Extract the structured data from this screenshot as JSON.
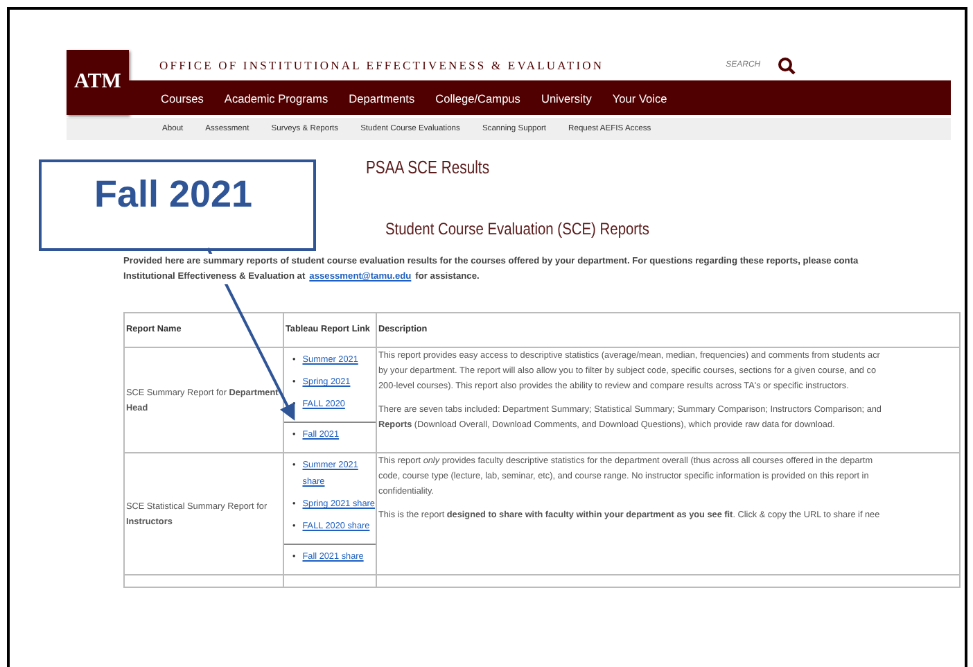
{
  "header": {
    "logo": "ATM",
    "site_title": "OFFICE OF INSTITUTIONAL EFFECTIVENESS & EVALUATION",
    "search_label": "SEARCH"
  },
  "main_nav": [
    "Courses",
    "Academic Programs",
    "Departments",
    "College/Campus",
    "University",
    "Your Voice"
  ],
  "sub_nav": [
    "About",
    "Assessment",
    "Surveys & Reports",
    "Student Course Evaluations",
    "Scanning Support",
    "Request AEFIS Access"
  ],
  "page_title": "PSAA SCE Results",
  "section_title": "Student Course Evaluation (SCE) Reports",
  "intro": {
    "line_1": "Provided here are summary reports of student course evaluation results for the courses offered by your department. For  questions regarding these reports, please conta",
    "line_2_before": "Institutional Effectiveness & Evaluation at",
    "line_2_link": "assessment@tamu.edu",
    "line_2_after": "for assistance."
  },
  "table": {
    "bullet": "•",
    "columns": [
      "Report Name",
      "Tableau Report Link",
      "Description"
    ],
    "rows": [
      {
        "name_prefix": "SCE Summary Report for",
        "name_bold": "Department Head",
        "link_groups": [
          [
            "Summer 2021",
            "Spring 2021",
            "FALL 2020"
          ],
          [
            "Fall 2021"
          ]
        ],
        "paragraphs": [
          [
            "This report provides easy access to descriptive statistics (average/mean, median, frequencies) and comments from students acr",
            "by your department.  The report will also allow you to filter by subject code, specific courses, sections for a given course, and co",
            "200-level courses).  This report also provides the ability to review and compare results across TA's or specific instructors."
          ],
          [
            "There are seven tabs included: Department Summary; Statistical Summary; Summary Comparison; Instructors Comparison; and",
            "**Reports** (Download Overall, Download Comments, and Download Questions), which provide raw data for download."
          ]
        ]
      },
      {
        "name_prefix": "SCE Statistical Summary Report for",
        "name_bold": "Instructors",
        "link_groups": [
          [
            "Summer 2021 share",
            "Spring 2021 share",
            "FALL 2020 share"
          ],
          [
            "Fall 2021 share"
          ]
        ],
        "paragraphs": [
          [
            "This report *only* provides faculty descriptive statistics for the department overall (thus across all courses offered in the departm",
            "code, course type (lecture, lab, seminar, etc), and course range.  No instructor specific information is provided on this report in",
            "confidentiality."
          ],
          [
            "This is the report **designed to share with faculty within your department as you see fit**. Click & copy the URL to share if nee"
          ]
        ]
      }
    ]
  },
  "callout": {
    "text": "Fall 2021"
  }
}
